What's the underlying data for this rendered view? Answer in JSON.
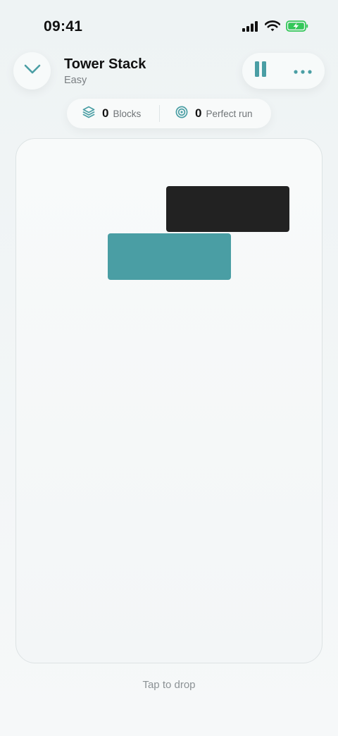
{
  "status_bar": {
    "time": "09:41",
    "icons": [
      "cellular-signal-icon",
      "wifi-icon",
      "battery-charging-icon"
    ]
  },
  "header": {
    "title": "Tower Stack",
    "difficulty": "Easy",
    "back_icon": "chevron-down-icon",
    "pause_icon": "pause-icon",
    "more_icon": "more-dots-icon"
  },
  "stats": {
    "blocks_value": "0",
    "blocks_label": "Blocks",
    "blocks_icon": "stack-layers-icon",
    "perfect_value": "0",
    "perfect_label": "Perfect run",
    "perfect_icon": "target-icon"
  },
  "board": {
    "hint": "Tap to drop"
  },
  "colors": {
    "accent": "#4a9ea4",
    "moving_block": "#222222",
    "base_block": "#4a9ea4",
    "battery": "#34c759"
  }
}
